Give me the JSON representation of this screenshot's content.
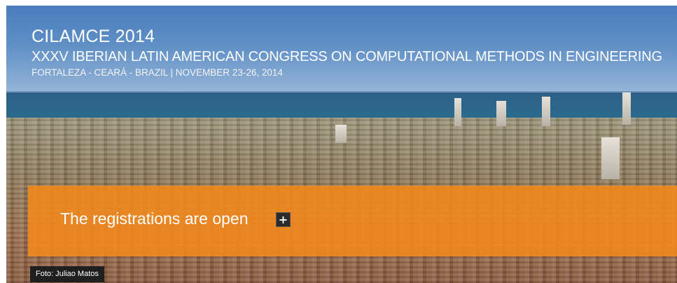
{
  "banner": {
    "title": "CILAMCE 2014",
    "subtitle": "XXXV IBERIAN LATIN AMERICAN CONGRESS ON COMPUTATIONAL METHODS IN ENGINEERING",
    "location": "FORTALEZA - CEARÁ - BRAZIL | NOVEMBER 23-26, 2014"
  },
  "overlay": {
    "text": "The registrations are open",
    "expand_icon": "plus-icon",
    "expand_symbol": "+",
    "color": "#f3891b"
  },
  "photo": {
    "credit": "Foto: Juliao Matos"
  }
}
